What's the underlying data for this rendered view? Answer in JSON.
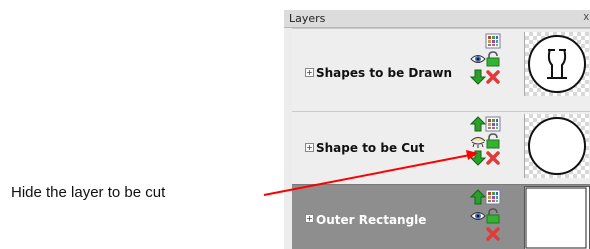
{
  "panel": {
    "title": "Layers",
    "close_glyph": "x"
  },
  "layers": [
    {
      "name": "Shapes to be Drawn",
      "expander": "+",
      "visibility_icon": "eye-icon",
      "selected": false
    },
    {
      "name": "Shape to be Cut",
      "expander": "+",
      "visibility_icon": "eye-closed-icon",
      "selected": false
    },
    {
      "name": "Outer Rectangle",
      "expander": "+",
      "visibility_icon": "eye-icon",
      "selected": true
    }
  ],
  "annotation": {
    "text": "Hide the layer to be cut"
  },
  "colors": {
    "accent_red": "#ff0000",
    "selected_row": "#8e8e8e",
    "arrow_green": "#2aa02a",
    "delete_red": "#e23a3a"
  }
}
